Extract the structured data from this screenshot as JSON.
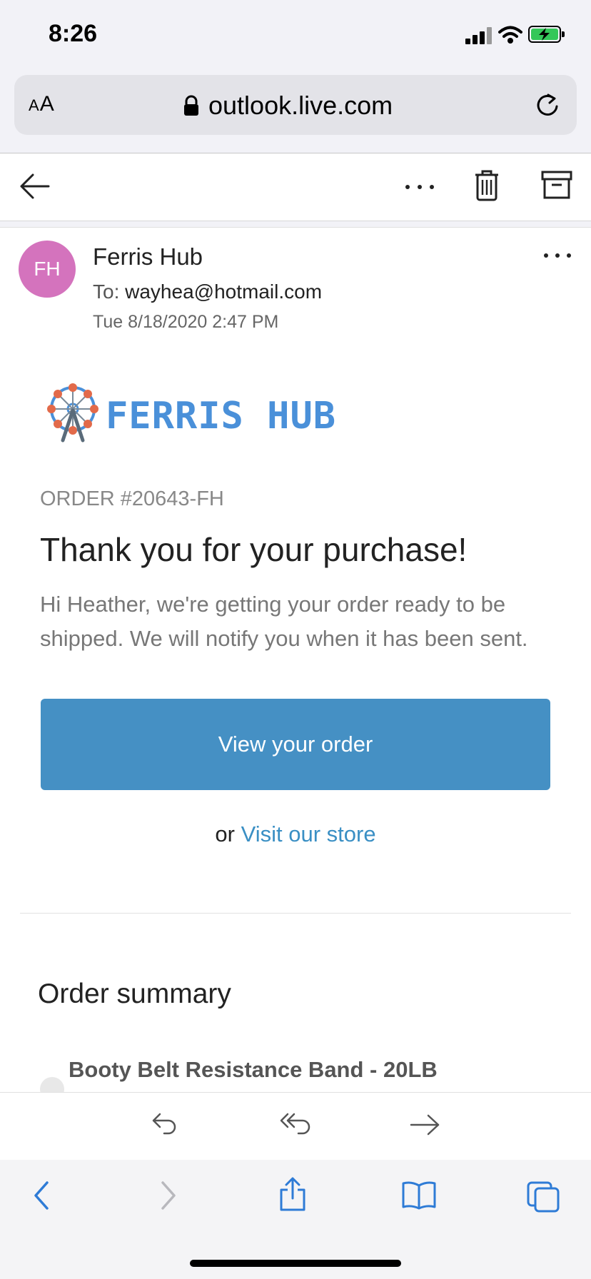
{
  "status_bar": {
    "time": "8:26"
  },
  "browser": {
    "text_size_label": "AA",
    "url": "outlook.live.com"
  },
  "email": {
    "avatar_initials": "FH",
    "sender": "Ferris Hub",
    "to_label": "To:",
    "to_address": "wayhea@hotmail.com",
    "date": "Tue 8/18/2020 2:47 PM",
    "brand_name": "FERRIS HUB",
    "order_number": "ORDER #20643-FH",
    "headline": "Thank you for your purchase!",
    "message": "Hi Heather, we're getting your order ready to be shipped. We will notify you when it has been sent.",
    "view_order_button": "View your order",
    "alt_prefix": "or",
    "visit_store_link": "Visit our store",
    "order_summary_heading": "Order summary",
    "items": [
      {
        "name": "Booty Belt Resistance Band - 20LB"
      }
    ]
  },
  "colors": {
    "avatar": "#d473bd",
    "brand": "#4a90d9",
    "button": "#4590c4",
    "link": "#3a8fc4",
    "safari_blue": "#2e7bd6",
    "battery": "#34c759"
  }
}
